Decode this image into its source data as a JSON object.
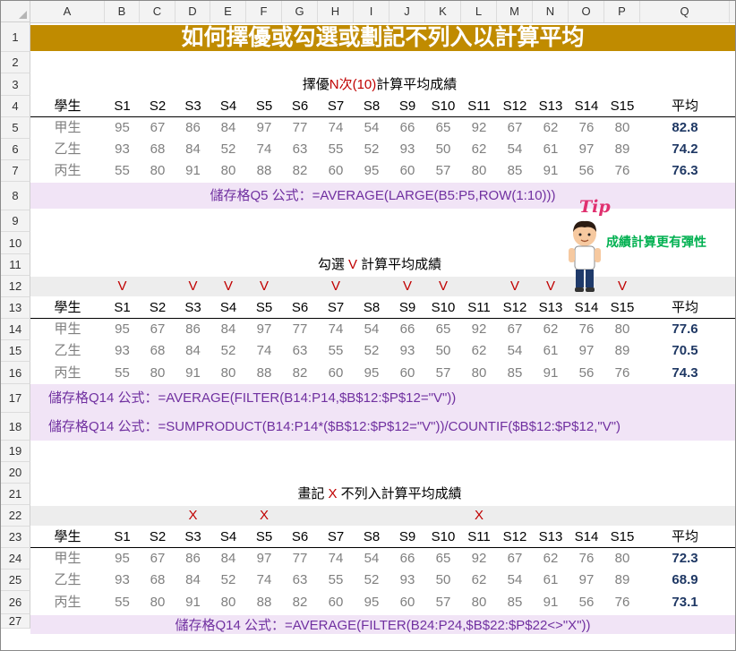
{
  "columns": [
    "A",
    "B",
    "C",
    "D",
    "E",
    "F",
    "G",
    "H",
    "I",
    "J",
    "K",
    "L",
    "M",
    "N",
    "O",
    "P",
    "Q"
  ],
  "rows": [
    "1",
    "2",
    "3",
    "4",
    "5",
    "6",
    "7",
    "8",
    "9",
    "10",
    "11",
    "12",
    "13",
    "14",
    "15",
    "16",
    "17",
    "18",
    "19",
    "20",
    "21",
    "22",
    "23",
    "24",
    "25",
    "26",
    "27"
  ],
  "title": "如何擇優或勾選或劃記不列入以計算平均",
  "headers": [
    "學生",
    "S1",
    "S2",
    "S3",
    "S4",
    "S5",
    "S6",
    "S7",
    "S8",
    "S9",
    "S10",
    "S11",
    "S12",
    "S13",
    "S14",
    "S15",
    "平均"
  ],
  "students": [
    "甲生",
    "乙生",
    "丙生"
  ],
  "scores": [
    [
      95,
      67,
      86,
      84,
      97,
      77,
      74,
      54,
      66,
      65,
      92,
      67,
      62,
      76,
      80
    ],
    [
      93,
      68,
      84,
      52,
      74,
      63,
      55,
      52,
      93,
      50,
      62,
      54,
      61,
      97,
      89
    ],
    [
      55,
      80,
      91,
      80,
      88,
      82,
      60,
      95,
      60,
      57,
      80,
      85,
      91,
      56,
      76
    ]
  ],
  "section1": {
    "title_a": "擇優",
    "title_b": "N次",
    "title_c": "(10)",
    "title_d": "計算平均成績",
    "averages": [
      "82.8",
      "74.2",
      "76.3"
    ],
    "formula": "儲存格Q5 公式：=AVERAGE(LARGE(B5:P5,ROW(1:10)))"
  },
  "section2": {
    "title_a": "勾選 ",
    "title_b": "V",
    "title_c": " 計算平均成績",
    "marks": [
      "V",
      "",
      "V",
      "V",
      "V",
      "",
      "V",
      "",
      "V",
      "V",
      "",
      "V",
      "V",
      "",
      "V"
    ],
    "averages": [
      "77.6",
      "70.5",
      "74.3"
    ],
    "formula1": "儲存格Q14 公式：=AVERAGE(FILTER(B14:P14,$B$12:$P$12=\"V\"))",
    "formula2": "儲存格Q14 公式：=SUMPRODUCT(B14:P14*($B$12:$P$12=\"V\"))/COUNTIF($B$12:$P$12,\"V\")"
  },
  "section3": {
    "title_a": "畫記 ",
    "title_b": "X",
    "title_c": " 不列入計算平均成績",
    "marks": [
      "",
      "",
      "X",
      "",
      "X",
      "",
      "",
      "",
      "",
      "",
      "X",
      "",
      "",
      "",
      ""
    ],
    "averages": [
      "72.3",
      "68.9",
      "73.1"
    ],
    "formula": "儲存格Q14 公式：=AVERAGE(FILTER(B24:P24,$B$22:$P$22<>\"X\"))"
  },
  "tip": {
    "logo": "Tip",
    "text": "成績計算更有彈性"
  }
}
